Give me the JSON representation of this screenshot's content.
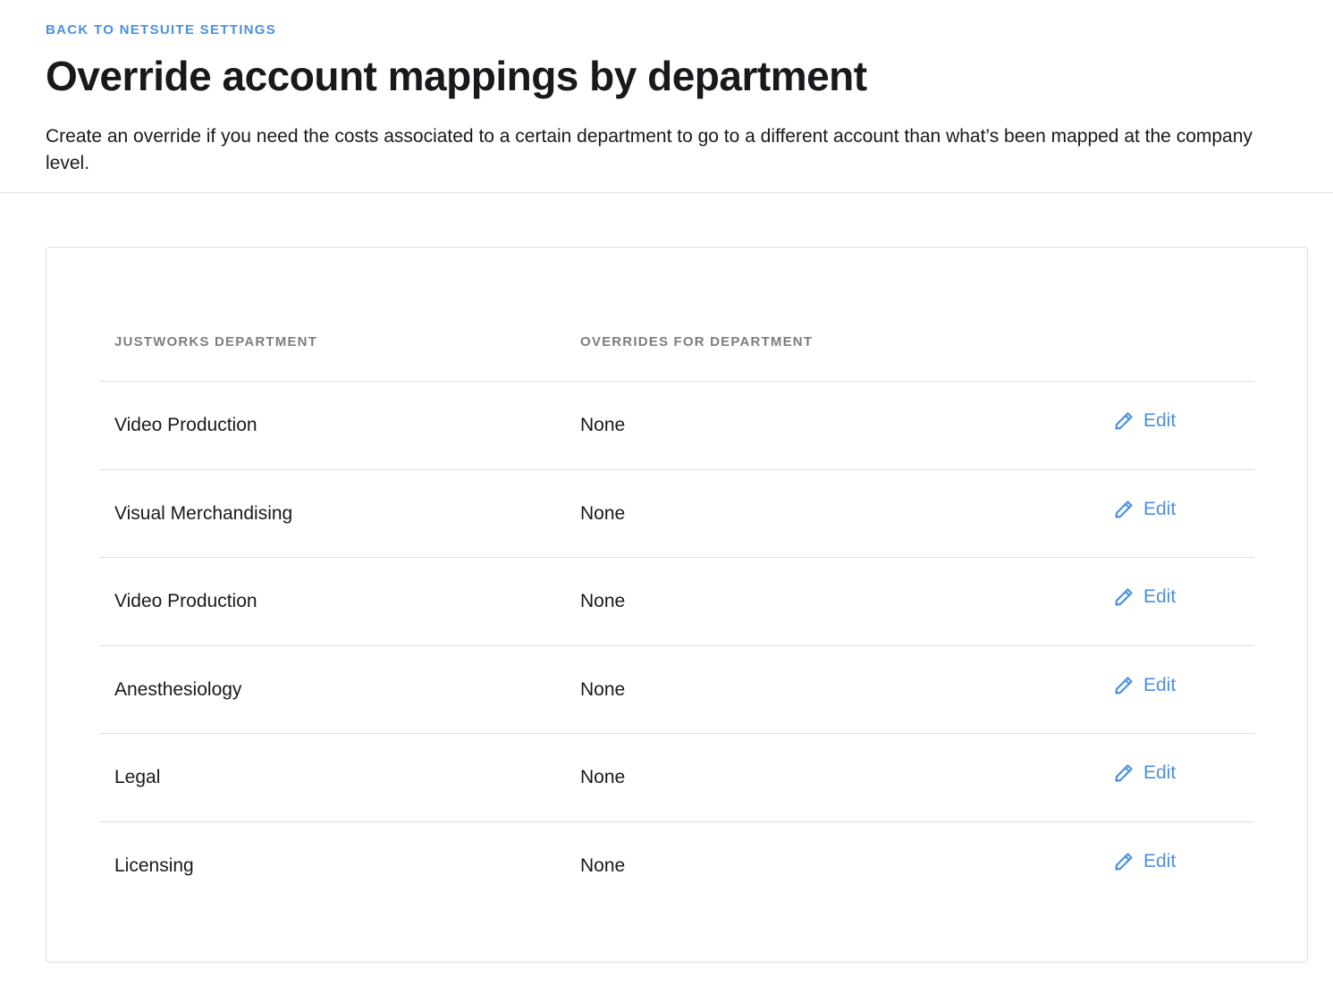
{
  "header": {
    "back_link": "BACK TO NETSUITE SETTINGS",
    "title": "Override account mappings by department",
    "description": "Create an override if you need the costs associated to a certain department to go to a different account than what’s been mapped at the company level."
  },
  "table": {
    "columns": [
      "JUSTWORKS DEPARTMENT",
      "OVERRIDES FOR DEPARTMENT"
    ],
    "edit_label": "Edit",
    "rows": [
      {
        "department": "Video Production",
        "override": "None"
      },
      {
        "department": "Visual Merchandising",
        "override": "None"
      },
      {
        "department": "Video Production",
        "override": "None"
      },
      {
        "department": "Anesthesiology",
        "override": "None"
      },
      {
        "department": "Legal",
        "override": "None"
      },
      {
        "department": "Licensing",
        "override": "None"
      }
    ]
  },
  "colors": {
    "accent": "#4a90e2",
    "text": "#17191c",
    "muted": "#7a7d83",
    "border": "#dcdde0"
  },
  "icons": {
    "edit": "pencil-icon"
  }
}
